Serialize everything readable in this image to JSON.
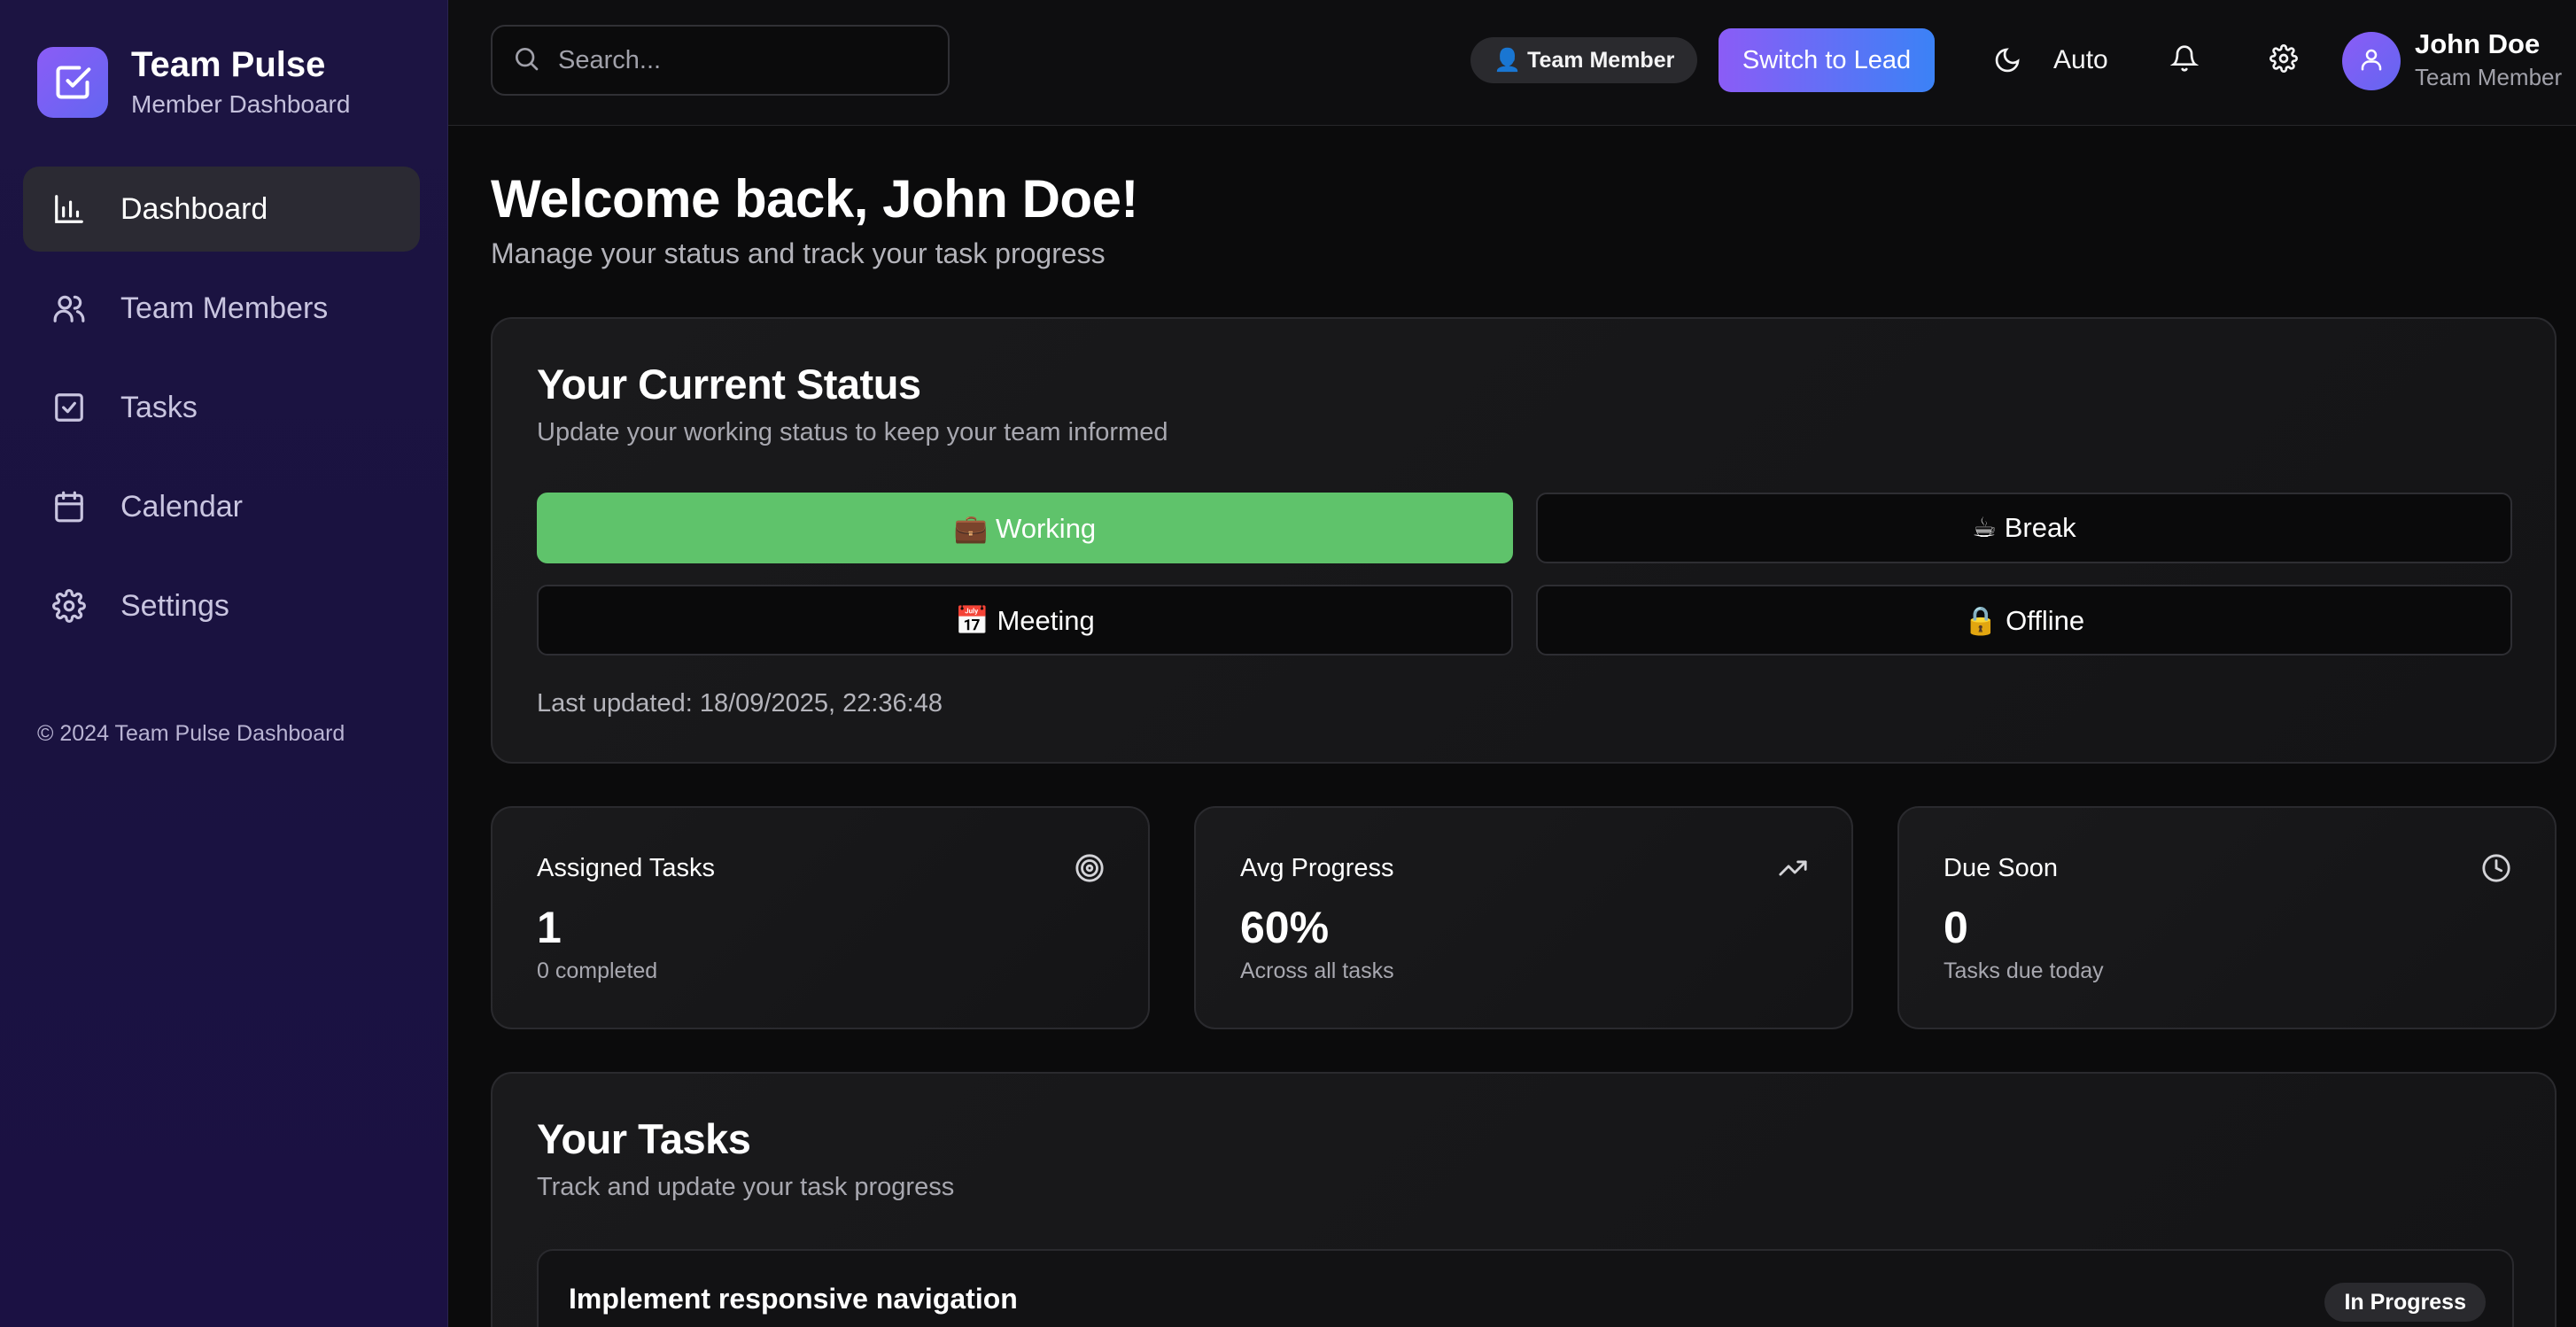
{
  "brand": {
    "title": "Team Pulse",
    "subtitle": "Member Dashboard"
  },
  "nav": [
    {
      "label": "Dashboard",
      "icon": "bar-chart-icon",
      "active": true
    },
    {
      "label": "Team Members",
      "icon": "users-icon"
    },
    {
      "label": "Tasks",
      "icon": "checkbox-icon"
    },
    {
      "label": "Calendar",
      "icon": "calendar-icon"
    },
    {
      "label": "Settings",
      "icon": "gear-icon"
    }
  ],
  "sidebar_footer": "© 2024 Team Pulse Dashboard",
  "topbar": {
    "search_placeholder": "Search...",
    "role_badge": "👤 Team Member",
    "switch_button": "Switch to Lead",
    "theme_label": "Auto",
    "user_name": "John Doe",
    "user_role": "Team Member"
  },
  "welcome": {
    "title": "Welcome back, John Doe!",
    "subtitle": "Manage your status and track your task progress"
  },
  "status": {
    "title": "Your Current Status",
    "subtitle": "Update your working status to keep your team informed",
    "options": [
      {
        "label": "💼 Working",
        "active": true
      },
      {
        "label": "☕ Break"
      },
      {
        "label": "📅 Meeting"
      },
      {
        "label": "🔒 Offline"
      }
    ],
    "last_updated": "Last updated: 18/09/2025, 22:36:48"
  },
  "stats": [
    {
      "label": "Assigned Tasks",
      "value": "1",
      "note": "0 completed",
      "icon": "target-icon"
    },
    {
      "label": "Avg Progress",
      "value": "60%",
      "note": "Across all tasks",
      "icon": "trending-up-icon"
    },
    {
      "label": "Due Soon",
      "value": "0",
      "note": "Tasks due today",
      "icon": "clock-icon"
    }
  ],
  "tasks": {
    "title": "Your Tasks",
    "subtitle": "Track and update your task progress",
    "items": [
      {
        "title": "Implement responsive navigation",
        "status": "In Progress"
      }
    ]
  },
  "colors": {
    "sidebar_bg": "#1c1442",
    "accent_purple": "#8b5cf6",
    "accent_blue": "#3b82f6",
    "status_active": "#5fc36b",
    "background": "#0b0b0c"
  }
}
